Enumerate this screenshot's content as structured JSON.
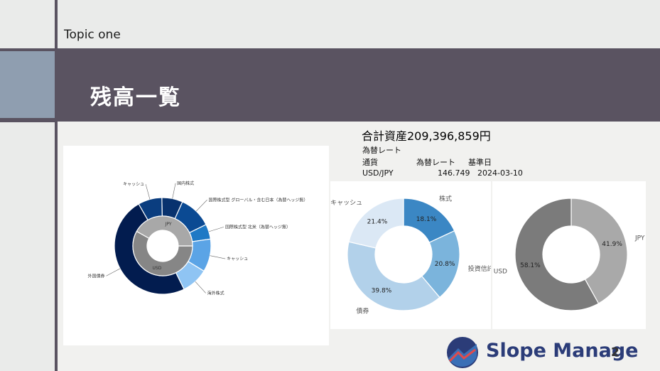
{
  "header": {
    "topic": "Topic one",
    "title": "残高一覧"
  },
  "summary": {
    "total": "合計資産209,396,859円",
    "fx_title": "為替レート",
    "fx_headers": [
      "通貨",
      "為替レート",
      "基準日"
    ],
    "fx_row": [
      "USD/JPY",
      "146.749",
      "2024-03-10"
    ]
  },
  "brand": {
    "name": "Slope Manage",
    "page": "2"
  },
  "chart_data": [
    {
      "type": "pie",
      "variant": "sunburst",
      "inner_ring": [
        {
          "label": "USD",
          "value": 58.1,
          "color": "#868686"
        },
        {
          "label": "JPY",
          "value": 41.9,
          "color": "#a8a8a8"
        }
      ],
      "outer_ring": [
        {
          "label": "国内株式",
          "value": 7,
          "color": "#08326e"
        },
        {
          "label": "国際株式型 グローバル・含む日本（為替ヘッジ無）",
          "value": 11,
          "color": "#0b4a93"
        },
        {
          "label": "国際株式型 北米（為替ヘッジ無）",
          "value": 5,
          "color": "#1e79c5"
        },
        {
          "label": "キャッシュ",
          "value": 11,
          "color": "#5ba4e6"
        },
        {
          "label": "海外株式",
          "value": 9,
          "color": "#8fc4f3"
        },
        {
          "label": "外国債券",
          "value": 49,
          "color": "#021c4f"
        },
        {
          "label": "キャッシュ",
          "value": 8,
          "color": "#0a3d7f"
        }
      ]
    },
    {
      "type": "pie",
      "variant": "donut",
      "slices": [
        {
          "label": "株式",
          "value": 18.1,
          "text": "18.1%",
          "color": "#3b87c4"
        },
        {
          "label": "投資信託",
          "value": 20.8,
          "text": "20.8%",
          "color": "#7bb4dc"
        },
        {
          "label": "債券",
          "value": 39.8,
          "text": "39.8%",
          "color": "#b2d1ea"
        },
        {
          "label": "キャッシュ",
          "value": 21.4,
          "text": "21.4%",
          "color": "#dbe8f5"
        }
      ]
    },
    {
      "type": "pie",
      "variant": "donut",
      "slices": [
        {
          "label": "JPY",
          "value": 41.9,
          "text": "41.9%",
          "color": "#a9a9a9"
        },
        {
          "label": "USD",
          "value": 58.1,
          "text": "58.1%",
          "color": "#7b7b7b"
        }
      ]
    }
  ]
}
